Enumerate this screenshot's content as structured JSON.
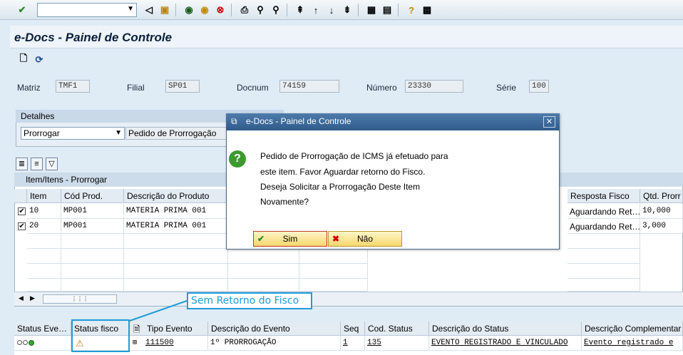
{
  "toolbar": {
    "command_value": ""
  },
  "screen": {
    "title": "e-Docs - Painel de Controle"
  },
  "header": {
    "matriz_label": "Matriz",
    "matriz_value": "TMF1",
    "filial_label": "Filial",
    "filial_value": "SP01",
    "docnum_label": "Docnum",
    "docnum_value": "74159",
    "numero_label": "Número",
    "numero_value": "23330",
    "serie_label": "Série",
    "serie_value": "100"
  },
  "detalhes": {
    "title": "Detalhes",
    "dropdown_value": "Prorrogar",
    "description": "Pedido de Prorrogação"
  },
  "items_table": {
    "title": "Item/Itens - Prorrogar",
    "columns": [
      "Item",
      "Cód Prod.",
      "Descrição do Produto",
      "Resposta Fisco",
      "Qtd. Prorr"
    ],
    "rows": [
      {
        "checked": true,
        "item": "10",
        "cod": "MP001",
        "desc": "MATERIA PRIMA 001",
        "resposta": "Aguardando Ret…",
        "qtd": "10,000"
      },
      {
        "checked": true,
        "item": "20",
        "cod": "MP001",
        "desc": "MATERIA PRIMA 001",
        "resposta": "Aguardando Ret…",
        "qtd": "3,000"
      }
    ]
  },
  "dialog": {
    "title": "e-Docs - Painel de Controle",
    "lines": [
      "Pedido de Prorrogação de ICMS já efetuado para",
      "este item. Favor Aguardar retorno do Fisco.",
      "Deseja Solicitar a Prorrogação Deste Item",
      "Novamente?"
    ],
    "yes_label": "Sim",
    "no_label": "Não"
  },
  "callout": {
    "text": "Sem Retorno do Fisco"
  },
  "events_table": {
    "columns": [
      "Status Eve…",
      "Status fisco",
      "Tipo Evento",
      "Descrição do Evento",
      "Seq",
      "Cod. Status",
      "Descrição do Status",
      "Descrição Complementar"
    ],
    "row": {
      "tipo": "111500",
      "descricao": "1º PRORROGAÇÃO",
      "seq": "1",
      "cod_status": "135",
      "desc_status": "EVENTO REGISTRADO E VINCULADO",
      "complementar": "Evento registrado e"
    }
  },
  "colors": {
    "accent": "#1e9cd8",
    "dialog_title": "#2f5b8c",
    "button": "#f5d76e"
  }
}
